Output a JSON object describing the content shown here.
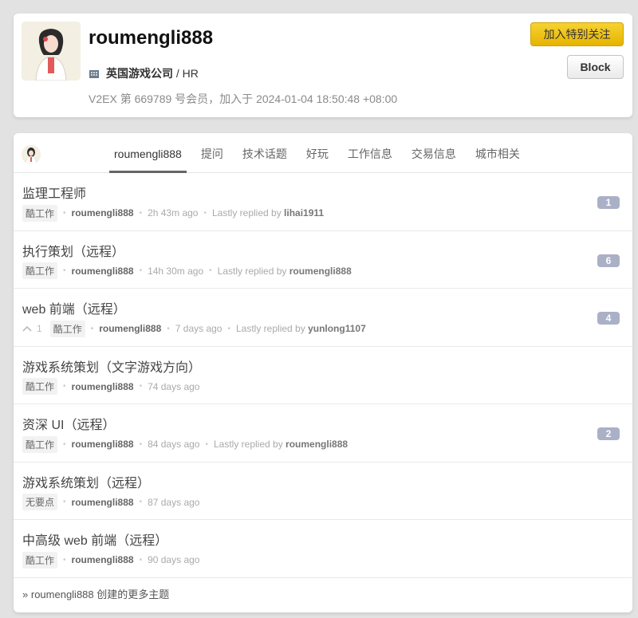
{
  "profile": {
    "username": "roumengli888",
    "company": "英国游戏公司",
    "role_sep": " / ",
    "role": "HR",
    "member_info": "V2EX 第 669789 号会员，加入于 2024-01-04 18:50:48 +08:00",
    "follow_label": "加入特别关注",
    "block_label": "Block"
  },
  "tabs": [
    {
      "label": "roumengli888",
      "active": true
    },
    {
      "label": "提问"
    },
    {
      "label": "技术话题"
    },
    {
      "label": "好玩"
    },
    {
      "label": "工作信息"
    },
    {
      "label": "交易信息"
    },
    {
      "label": "城市相关"
    }
  ],
  "topics": [
    {
      "title": "监理工程师",
      "node": "酷工作",
      "author": "roumengli888",
      "time": "2h 43m ago",
      "replied_prefix": "Lastly replied by",
      "last_reply": "lihai1911",
      "count": "1"
    },
    {
      "title": "执行策划（远程）",
      "node": "酷工作",
      "author": "roumengli888",
      "time": "14h 30m ago",
      "replied_prefix": "Lastly replied by",
      "last_reply": "roumengli888",
      "count": "6"
    },
    {
      "title": "web 前端（远程）",
      "votes": "1",
      "node": "酷工作",
      "author": "roumengli888",
      "time": "7 days ago",
      "replied_prefix": "Lastly replied by",
      "last_reply": "yunlong1107",
      "count": "4"
    },
    {
      "title": "游戏系统策划（文字游戏方向）",
      "node": "酷工作",
      "author": "roumengli888",
      "time": "74 days ago"
    },
    {
      "title": "资深 UI（远程）",
      "node": "酷工作",
      "author": "roumengli888",
      "time": "84 days ago",
      "replied_prefix": "Lastly replied by",
      "last_reply": "roumengli888",
      "count": "2"
    },
    {
      "title": "游戏系统策划（远程）",
      "node": "无要点",
      "author": "roumengli888",
      "time": "87 days ago"
    },
    {
      "title": "中高级 web 前端（远程）",
      "node": "酷工作",
      "author": "roumengli888",
      "time": "90 days ago"
    }
  ],
  "more": {
    "arrow": "»",
    "label": "roumengli888 创建的更多主题"
  },
  "icons": {
    "company": "building-icon",
    "vote": "chevron-up-icon"
  },
  "colors": {
    "follow_button": "#f0c419",
    "reply_count_badge": "#aab0c6"
  }
}
